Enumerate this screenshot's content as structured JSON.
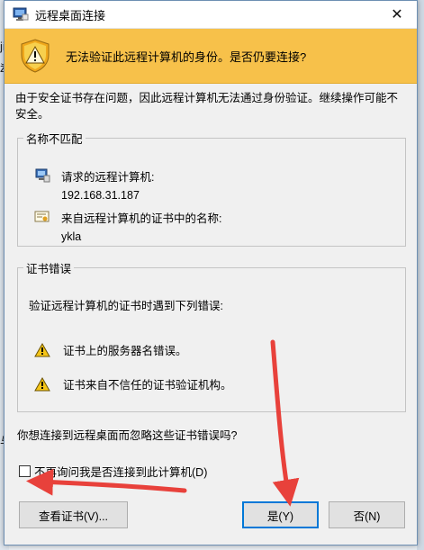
{
  "background": {
    "fragments": [
      "jie",
      "ž",
      "与"
    ]
  },
  "dialog": {
    "title": "远程桌面连接",
    "close_glyph": "✕",
    "banner_text": "无法验证此远程计算机的身份。是否仍要连接?",
    "intro": "由于安全证书存在问题，因此远程计算机无法通过身份验证。继续操作可能不安全。",
    "name_mismatch": {
      "legend": "名称不匹配",
      "requested_label": "请求的远程计算机:",
      "requested_value": "192.168.31.187",
      "cert_name_label": "来自远程计算机的证书中的名称:",
      "cert_name_value": "ykla"
    },
    "cert_errors": {
      "legend": "证书错误",
      "intro": "验证远程计算机的证书时遇到下列错误:",
      "errors": [
        "证书上的服务器名错误。",
        "证书来自不信任的证书验证机构。"
      ]
    },
    "question": "你想连接到远程桌面而忽略这些证书错误吗?",
    "checkbox_label": "不再询问我是否连接到此计算机(D)",
    "checkbox_checked": false,
    "buttons": {
      "view_cert": "查看证书(V)...",
      "yes": "是(Y)",
      "no": "否(N)"
    }
  },
  "colors": {
    "banner": "#f7c14a",
    "annotation_arrow": "#e8413b",
    "default_button_border": "#0078d7"
  }
}
